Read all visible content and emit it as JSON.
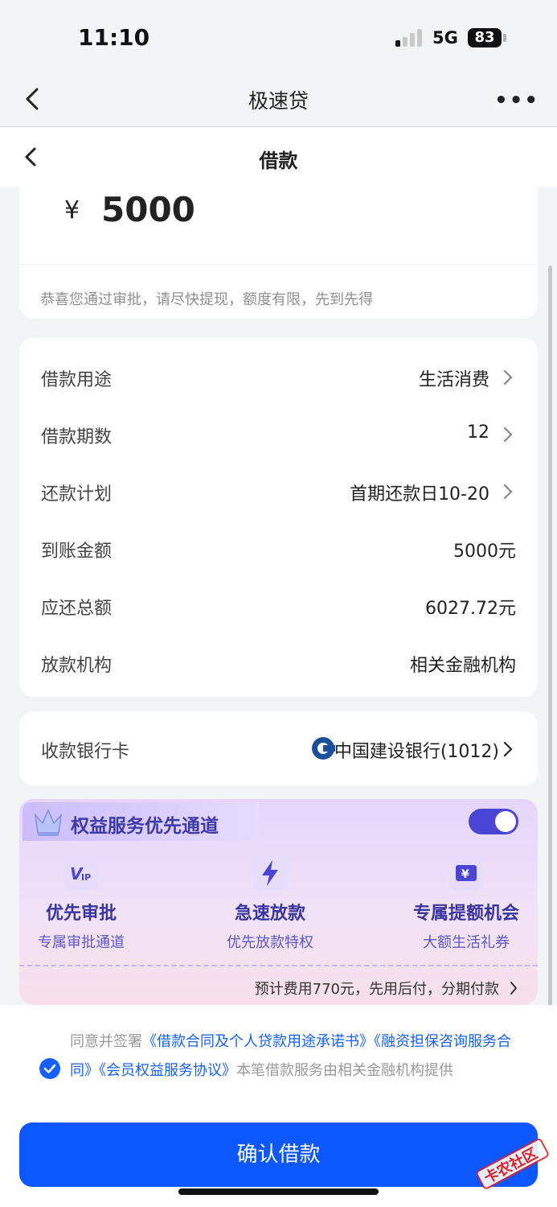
{
  "status_bar": {
    "time": "11:10",
    "network": "5G",
    "battery": "83"
  },
  "nav": {
    "title": "极速贷"
  },
  "subnav": {
    "title": "借款"
  },
  "amount": {
    "currency": "¥",
    "value": "5000",
    "note": "恭喜您通过审批，请尽快提现，额度有限，先到先得"
  },
  "details": [
    {
      "label": "借款用途",
      "value": "生活消费",
      "arrow": true
    },
    {
      "label": "借款期数",
      "value": "12",
      "arrow": true
    },
    {
      "label": "还款计划",
      "value": "首期还款日10-20",
      "arrow": true
    },
    {
      "label": "到账金额",
      "value": "5000元",
      "arrow": false
    },
    {
      "label": "应还总额",
      "value": "6027.72元",
      "arrow": false
    },
    {
      "label": "放款机构",
      "value": "相关金融机构",
      "arrow": false
    }
  ],
  "bank": {
    "label": "收款银行卡",
    "name": "中国建设银行(1012)"
  },
  "benefit": {
    "title": "权益服务优先通道",
    "toggle_on": true,
    "perks": [
      {
        "icon": "vip-icon",
        "name": "优先审批",
        "desc": "专属审批通道"
      },
      {
        "icon": "lightning-icon",
        "name": "急速放款",
        "desc": "优先放款特权"
      },
      {
        "icon": "yen-coupon-icon",
        "name": "专属提额机会",
        "desc": "大额生活礼券"
      }
    ],
    "fee_note": "预计费用770元，先用后付，分期付款"
  },
  "agreement": {
    "checked": true,
    "prefix": "同意并签署",
    "link1": "《借款合同及个人贷款用途承诺书》",
    "link2": "《融资担保咨询服务合同》",
    "link3": "《会员权益服务协议》",
    "suffix": "本笔借款服务由相关金融机构提供"
  },
  "confirm_button": "确认借款",
  "watermark": "卡农社区",
  "colors": {
    "primary": "#0d57ff",
    "link": "#1660ff",
    "benefit_text": "#3a35a0",
    "toggle": "#4b45d6"
  }
}
